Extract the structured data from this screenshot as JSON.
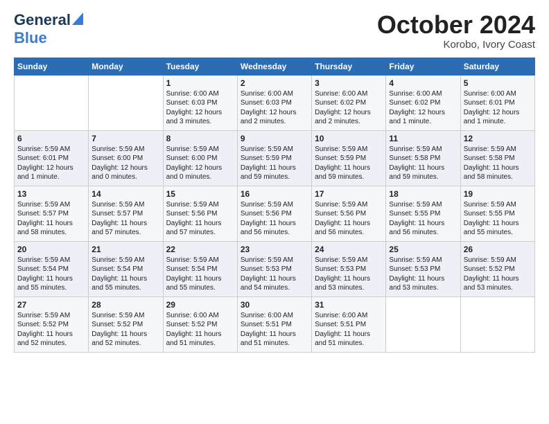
{
  "header": {
    "logo_line1": "General",
    "logo_line2": "Blue",
    "month": "October 2024",
    "location": "Korobo, Ivory Coast"
  },
  "weekdays": [
    "Sunday",
    "Monday",
    "Tuesday",
    "Wednesday",
    "Thursday",
    "Friday",
    "Saturday"
  ],
  "weeks": [
    [
      {
        "day": "",
        "lines": []
      },
      {
        "day": "",
        "lines": []
      },
      {
        "day": "1",
        "lines": [
          "Sunrise: 6:00 AM",
          "Sunset: 6:03 PM",
          "Daylight: 12 hours",
          "and 3 minutes."
        ]
      },
      {
        "day": "2",
        "lines": [
          "Sunrise: 6:00 AM",
          "Sunset: 6:03 PM",
          "Daylight: 12 hours",
          "and 2 minutes."
        ]
      },
      {
        "day": "3",
        "lines": [
          "Sunrise: 6:00 AM",
          "Sunset: 6:02 PM",
          "Daylight: 12 hours",
          "and 2 minutes."
        ]
      },
      {
        "day": "4",
        "lines": [
          "Sunrise: 6:00 AM",
          "Sunset: 6:02 PM",
          "Daylight: 12 hours",
          "and 1 minute."
        ]
      },
      {
        "day": "5",
        "lines": [
          "Sunrise: 6:00 AM",
          "Sunset: 6:01 PM",
          "Daylight: 12 hours",
          "and 1 minute."
        ]
      }
    ],
    [
      {
        "day": "6",
        "lines": [
          "Sunrise: 5:59 AM",
          "Sunset: 6:01 PM",
          "Daylight: 12 hours",
          "and 1 minute."
        ]
      },
      {
        "day": "7",
        "lines": [
          "Sunrise: 5:59 AM",
          "Sunset: 6:00 PM",
          "Daylight: 12 hours",
          "and 0 minutes."
        ]
      },
      {
        "day": "8",
        "lines": [
          "Sunrise: 5:59 AM",
          "Sunset: 6:00 PM",
          "Daylight: 12 hours",
          "and 0 minutes."
        ]
      },
      {
        "day": "9",
        "lines": [
          "Sunrise: 5:59 AM",
          "Sunset: 5:59 PM",
          "Daylight: 11 hours",
          "and 59 minutes."
        ]
      },
      {
        "day": "10",
        "lines": [
          "Sunrise: 5:59 AM",
          "Sunset: 5:59 PM",
          "Daylight: 11 hours",
          "and 59 minutes."
        ]
      },
      {
        "day": "11",
        "lines": [
          "Sunrise: 5:59 AM",
          "Sunset: 5:58 PM",
          "Daylight: 11 hours",
          "and 59 minutes."
        ]
      },
      {
        "day": "12",
        "lines": [
          "Sunrise: 5:59 AM",
          "Sunset: 5:58 PM",
          "Daylight: 11 hours",
          "and 58 minutes."
        ]
      }
    ],
    [
      {
        "day": "13",
        "lines": [
          "Sunrise: 5:59 AM",
          "Sunset: 5:57 PM",
          "Daylight: 11 hours",
          "and 58 minutes."
        ]
      },
      {
        "day": "14",
        "lines": [
          "Sunrise: 5:59 AM",
          "Sunset: 5:57 PM",
          "Daylight: 11 hours",
          "and 57 minutes."
        ]
      },
      {
        "day": "15",
        "lines": [
          "Sunrise: 5:59 AM",
          "Sunset: 5:56 PM",
          "Daylight: 11 hours",
          "and 57 minutes."
        ]
      },
      {
        "day": "16",
        "lines": [
          "Sunrise: 5:59 AM",
          "Sunset: 5:56 PM",
          "Daylight: 11 hours",
          "and 56 minutes."
        ]
      },
      {
        "day": "17",
        "lines": [
          "Sunrise: 5:59 AM",
          "Sunset: 5:56 PM",
          "Daylight: 11 hours",
          "and 56 minutes."
        ]
      },
      {
        "day": "18",
        "lines": [
          "Sunrise: 5:59 AM",
          "Sunset: 5:55 PM",
          "Daylight: 11 hours",
          "and 56 minutes."
        ]
      },
      {
        "day": "19",
        "lines": [
          "Sunrise: 5:59 AM",
          "Sunset: 5:55 PM",
          "Daylight: 11 hours",
          "and 55 minutes."
        ]
      }
    ],
    [
      {
        "day": "20",
        "lines": [
          "Sunrise: 5:59 AM",
          "Sunset: 5:54 PM",
          "Daylight: 11 hours",
          "and 55 minutes."
        ]
      },
      {
        "day": "21",
        "lines": [
          "Sunrise: 5:59 AM",
          "Sunset: 5:54 PM",
          "Daylight: 11 hours",
          "and 55 minutes."
        ]
      },
      {
        "day": "22",
        "lines": [
          "Sunrise: 5:59 AM",
          "Sunset: 5:54 PM",
          "Daylight: 11 hours",
          "and 55 minutes."
        ]
      },
      {
        "day": "23",
        "lines": [
          "Sunrise: 5:59 AM",
          "Sunset: 5:53 PM",
          "Daylight: 11 hours",
          "and 54 minutes."
        ]
      },
      {
        "day": "24",
        "lines": [
          "Sunrise: 5:59 AM",
          "Sunset: 5:53 PM",
          "Daylight: 11 hours",
          "and 53 minutes."
        ]
      },
      {
        "day": "25",
        "lines": [
          "Sunrise: 5:59 AM",
          "Sunset: 5:53 PM",
          "Daylight: 11 hours",
          "and 53 minutes."
        ]
      },
      {
        "day": "26",
        "lines": [
          "Sunrise: 5:59 AM",
          "Sunset: 5:52 PM",
          "Daylight: 11 hours",
          "and 53 minutes."
        ]
      }
    ],
    [
      {
        "day": "27",
        "lines": [
          "Sunrise: 5:59 AM",
          "Sunset: 5:52 PM",
          "Daylight: 11 hours",
          "and 52 minutes."
        ]
      },
      {
        "day": "28",
        "lines": [
          "Sunrise: 5:59 AM",
          "Sunset: 5:52 PM",
          "Daylight: 11 hours",
          "and 52 minutes."
        ]
      },
      {
        "day": "29",
        "lines": [
          "Sunrise: 6:00 AM",
          "Sunset: 5:52 PM",
          "Daylight: 11 hours",
          "and 51 minutes."
        ]
      },
      {
        "day": "30",
        "lines": [
          "Sunrise: 6:00 AM",
          "Sunset: 5:51 PM",
          "Daylight: 11 hours",
          "and 51 minutes."
        ]
      },
      {
        "day": "31",
        "lines": [
          "Sunrise: 6:00 AM",
          "Sunset: 5:51 PM",
          "Daylight: 11 hours",
          "and 51 minutes."
        ]
      },
      {
        "day": "",
        "lines": []
      },
      {
        "day": "",
        "lines": []
      }
    ]
  ]
}
